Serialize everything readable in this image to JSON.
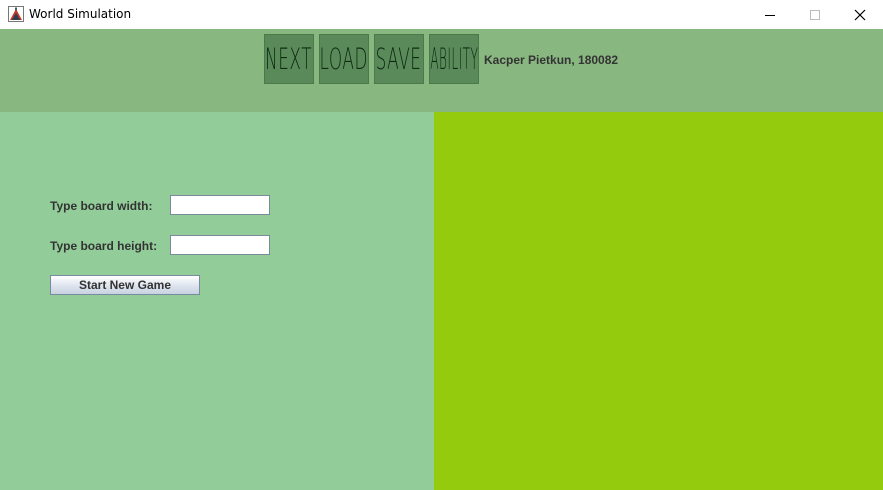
{
  "window": {
    "title": "World Simulation",
    "app_icon": "java-app-icon",
    "controls": [
      "minimize-icon",
      "maximize-icon",
      "close-icon"
    ]
  },
  "toolbar": {
    "buttons": [
      {
        "label": "NEXT"
      },
      {
        "label": "LOAD"
      },
      {
        "label": "SAVE"
      },
      {
        "label": "ABILITY"
      }
    ],
    "author": "Kacper Pietkun, 180082"
  },
  "form": {
    "width_label": "Type board width:",
    "width_value": "",
    "height_label": "Type board height:",
    "height_value": "",
    "start_label": "Start New Game"
  },
  "colors": {
    "toolbar_bg": "#89b780",
    "tool_button_bg": "#5a8a5a",
    "form_panel_bg": "#92cd99",
    "board_bg": "#94cb0c"
  }
}
